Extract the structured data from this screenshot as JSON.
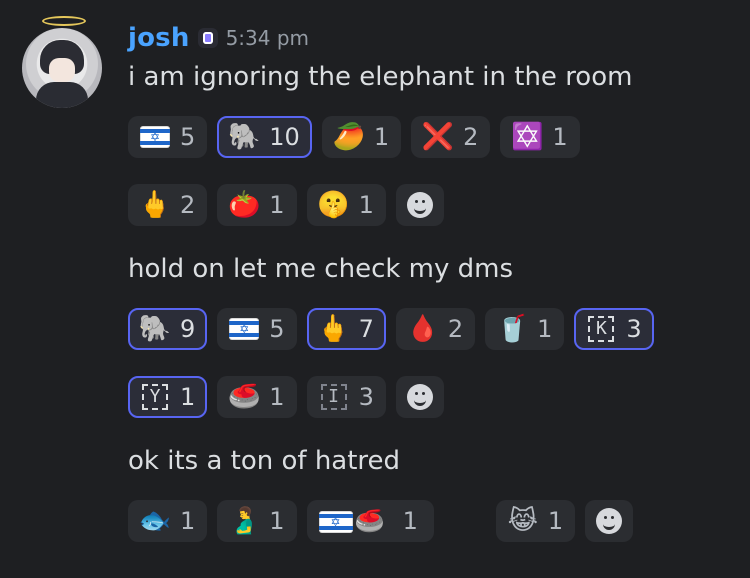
{
  "user": {
    "name": "josh",
    "timestamp": "5:34 pm"
  },
  "messages": [
    {
      "text": "i am ignoring the elephant in the room",
      "reaction_rows": [
        [
          {
            "emoji_name": "israel-flag",
            "emoji": "🇮🇱",
            "count": "5",
            "selected": false
          },
          {
            "emoji_name": "elephant",
            "emoji": "🐘",
            "count": "10",
            "selected": true
          },
          {
            "emoji_name": "mango",
            "emoji": "🥭",
            "count": "1",
            "selected": false
          },
          {
            "emoji_name": "cross-mark",
            "emoji": "❌",
            "count": "2",
            "selected": false
          },
          {
            "emoji_name": "star-of-david",
            "emoji": "✡️",
            "count": "1",
            "selected": false
          }
        ],
        [
          {
            "emoji_name": "middle-finger",
            "emoji": "🖕",
            "count": "2",
            "selected": false
          },
          {
            "emoji_name": "tomato",
            "emoji": "🍅",
            "count": "1",
            "selected": false
          },
          {
            "emoji_name": "shushing-face",
            "emoji": "🤫",
            "count": "1",
            "selected": false
          }
        ]
      ]
    },
    {
      "text": "hold on let me check my dms",
      "reaction_rows": [
        [
          {
            "emoji_name": "elephant",
            "emoji": "🐘",
            "count": "9",
            "selected": true
          },
          {
            "emoji_name": "israel-flag",
            "emoji": "🇮🇱",
            "count": "5",
            "selected": false
          },
          {
            "emoji_name": "middle-finger",
            "emoji": "🖕",
            "count": "7",
            "selected": true
          },
          {
            "emoji_name": "drop-of-blood",
            "emoji": "🩸",
            "count": "2",
            "selected": false
          },
          {
            "emoji_name": "cup-with-straw",
            "emoji": "🥤",
            "count": "1",
            "selected": false
          },
          {
            "emoji_name": "k-key",
            "label": "K",
            "count": "3",
            "selected": true
          }
        ],
        [
          {
            "emoji_name": "y-key",
            "label": "Y",
            "count": "1",
            "selected": true
          },
          {
            "emoji_name": "curling-stone",
            "emoji": "🥌",
            "count": "1",
            "selected": false
          },
          {
            "emoji_name": "i-key",
            "label": "I",
            "count": "3",
            "selected": false
          }
        ]
      ]
    },
    {
      "text": "ok its a ton of hatred",
      "reaction_rows": [
        [
          {
            "emoji_name": "fish",
            "emoji": "🐟",
            "count": "1",
            "selected": false
          },
          {
            "emoji_name": "pregnant-man",
            "emoji": "🫃",
            "count": "1",
            "selected": false
          },
          {
            "emoji_name": "israel-flag-and-curling-stone",
            "emoji": "🇮🇱🥌",
            "count": "1",
            "selected": false
          },
          {
            "emoji_name": "cat-tears-of-joy",
            "emoji": "😹",
            "count": "1",
            "selected": false
          }
        ]
      ]
    }
  ]
}
